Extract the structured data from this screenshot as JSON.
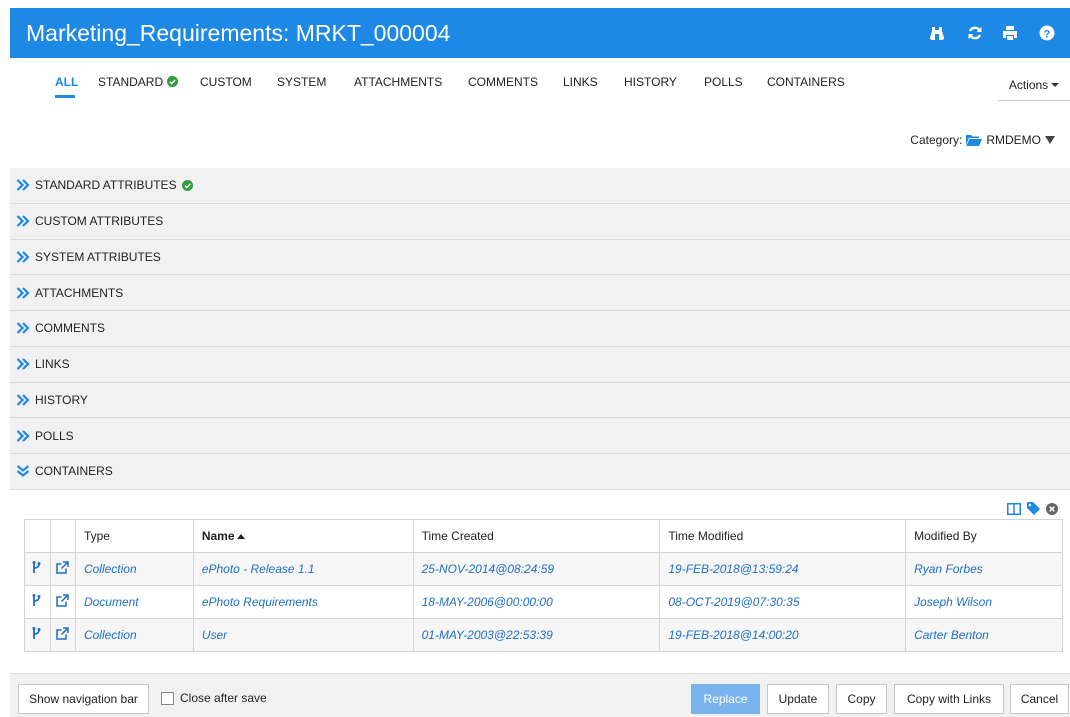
{
  "header": {
    "title": "Marketing_Requirements: MRKT_000004",
    "icons": [
      "binoculars-icon",
      "refresh-icon",
      "print-icon",
      "help-icon"
    ]
  },
  "tabs": [
    {
      "label": "ALL",
      "active": true
    },
    {
      "label": "STANDARD",
      "check": true
    },
    {
      "label": "CUSTOM"
    },
    {
      "label": "SYSTEM"
    },
    {
      "label": "ATTACHMENTS"
    },
    {
      "label": "COMMENTS"
    },
    {
      "label": "LINKS"
    },
    {
      "label": "HISTORY"
    },
    {
      "label": "POLLS"
    },
    {
      "label": "CONTAINERS"
    }
  ],
  "actions": {
    "label": "Actions"
  },
  "category": {
    "label": "Category:",
    "value": "RMDEMO"
  },
  "sections": [
    {
      "label": "STANDARD ATTRIBUTES",
      "check": true,
      "expanded": false
    },
    {
      "label": "CUSTOM ATTRIBUTES",
      "expanded": false
    },
    {
      "label": "SYSTEM ATTRIBUTES",
      "expanded": false
    },
    {
      "label": "ATTACHMENTS",
      "expanded": false
    },
    {
      "label": "COMMENTS",
      "expanded": false
    },
    {
      "label": "LINKS",
      "expanded": false
    },
    {
      "label": "HISTORY",
      "expanded": false
    },
    {
      "label": "POLLS",
      "expanded": false
    },
    {
      "label": "CONTAINERS",
      "expanded": true
    }
  ],
  "table": {
    "columns": [
      "Type",
      "Name",
      "Time Created",
      "Time Modified",
      "Modified By"
    ],
    "sorted_column": "Name",
    "rows": [
      {
        "type": "Collection",
        "name": "ePhoto - Release 1.1",
        "created": "25-NOV-2014@08:24:59",
        "modified": "19-FEB-2018@13:59:24",
        "modified_by": "Ryan Forbes"
      },
      {
        "type": "Document",
        "name": "ePhoto Requirements",
        "created": "18-MAY-2006@00:00:00",
        "modified": "08-OCT-2019@07:30:35",
        "modified_by": "Joseph Wilson"
      },
      {
        "type": "Collection",
        "name": "User",
        "created": "01-MAY-2003@22:53:39",
        "modified": "19-FEB-2018@14:00:20",
        "modified_by": "Carter Benton"
      }
    ]
  },
  "footer": {
    "show_nav": "Show navigation bar",
    "close_after_save": "Close after save",
    "replace": "Replace",
    "update": "Update",
    "copy": "Copy",
    "copy_links": "Copy with Links",
    "cancel": "Cancel"
  },
  "colors": {
    "accent": "#1e88e5",
    "link": "#1e6fc8",
    "success": "#2e9e3e"
  }
}
